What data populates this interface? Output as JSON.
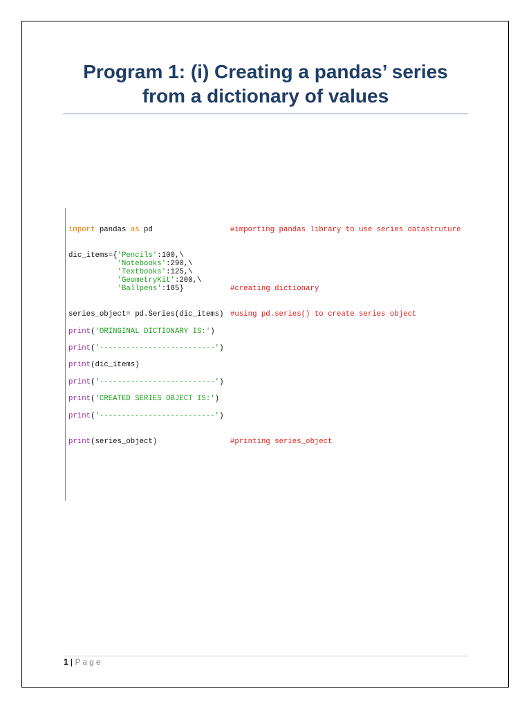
{
  "title": {
    "line1": "Program 1: (i) Creating a pandas’ series",
    "line2": "from a dictionary of values"
  },
  "code": [
    {
      "segments": [
        {
          "t": "import",
          "c": "kw"
        },
        {
          "t": " pandas ",
          "c": "pl"
        },
        {
          "t": "as",
          "c": "kw"
        },
        {
          "t": " pd",
          "c": "pl"
        }
      ],
      "comment": "#importing pandas library to use series datastruture"
    },
    {
      "segments": [
        {
          "t": "dic_items={",
          "c": "pl"
        },
        {
          "t": "'Pencils'",
          "c": "st"
        },
        {
          "t": ":100,\\",
          "c": "pl"
        }
      ],
      "comment": ""
    },
    {
      "segments": [
        {
          "t": "           ",
          "c": "pl"
        },
        {
          "t": "'Notebooks'",
          "c": "st"
        },
        {
          "t": ":290,\\",
          "c": "pl"
        }
      ],
      "comment": ""
    },
    {
      "segments": [
        {
          "t": "           ",
          "c": "pl"
        },
        {
          "t": "'Textbooks'",
          "c": "st"
        },
        {
          "t": ":125,\\",
          "c": "pl"
        }
      ],
      "comment": ""
    },
    {
      "segments": [
        {
          "t": "           ",
          "c": "pl"
        },
        {
          "t": "'GeometryKit'",
          "c": "st"
        },
        {
          "t": ":200,\\",
          "c": "pl"
        }
      ],
      "comment": ""
    },
    {
      "segments": [
        {
          "t": "           ",
          "c": "pl"
        },
        {
          "t": "'Ballpens'",
          "c": "st"
        },
        {
          "t": ":185}",
          "c": "pl"
        }
      ],
      "comment": "#creating dictionary"
    },
    {
      "segments": [
        {
          "t": "series_object= pd.Series(dic_items)",
          "c": "pl"
        }
      ],
      "comment": "#using pd.series() to create series object"
    },
    {
      "segments": [
        {
          "t": "print",
          "c": "fn"
        },
        {
          "t": "(",
          "c": "pl"
        },
        {
          "t": "'ORINGINAL DICTIONARY IS:'",
          "c": "st"
        },
        {
          "t": ")",
          "c": "pl"
        }
      ],
      "comment": ""
    },
    {
      "segments": [
        {
          "t": "print",
          "c": "fn"
        },
        {
          "t": "(",
          "c": "pl"
        },
        {
          "t": "'--------------------------'",
          "c": "st"
        },
        {
          "t": ")",
          "c": "pl"
        }
      ],
      "comment": ""
    },
    {
      "segments": [
        {
          "t": "print",
          "c": "fn"
        },
        {
          "t": "(dic_items)",
          "c": "pl"
        }
      ],
      "comment": ""
    },
    {
      "segments": [
        {
          "t": "print",
          "c": "fn"
        },
        {
          "t": "(",
          "c": "pl"
        },
        {
          "t": "'--------------------------'",
          "c": "st"
        },
        {
          "t": ")",
          "c": "pl"
        }
      ],
      "comment": ""
    },
    {
      "segments": [
        {
          "t": "print",
          "c": "fn"
        },
        {
          "t": "(",
          "c": "pl"
        },
        {
          "t": "'CREATED SERIES OBJECT IS:'",
          "c": "st"
        },
        {
          "t": ")",
          "c": "pl"
        }
      ],
      "comment": ""
    },
    {
      "segments": [
        {
          "t": "print",
          "c": "fn"
        },
        {
          "t": "(",
          "c": "pl"
        },
        {
          "t": "'--------------------------'",
          "c": "st"
        },
        {
          "t": ")",
          "c": "pl"
        }
      ],
      "comment": ""
    },
    {
      "segments": [
        {
          "t": "print",
          "c": "fn"
        },
        {
          "t": "(series_object)",
          "c": "pl"
        }
      ],
      "comment": "#printing series_object"
    }
  ],
  "footer": {
    "page_number": "1",
    "separator": " | ",
    "page_label": "Page"
  }
}
